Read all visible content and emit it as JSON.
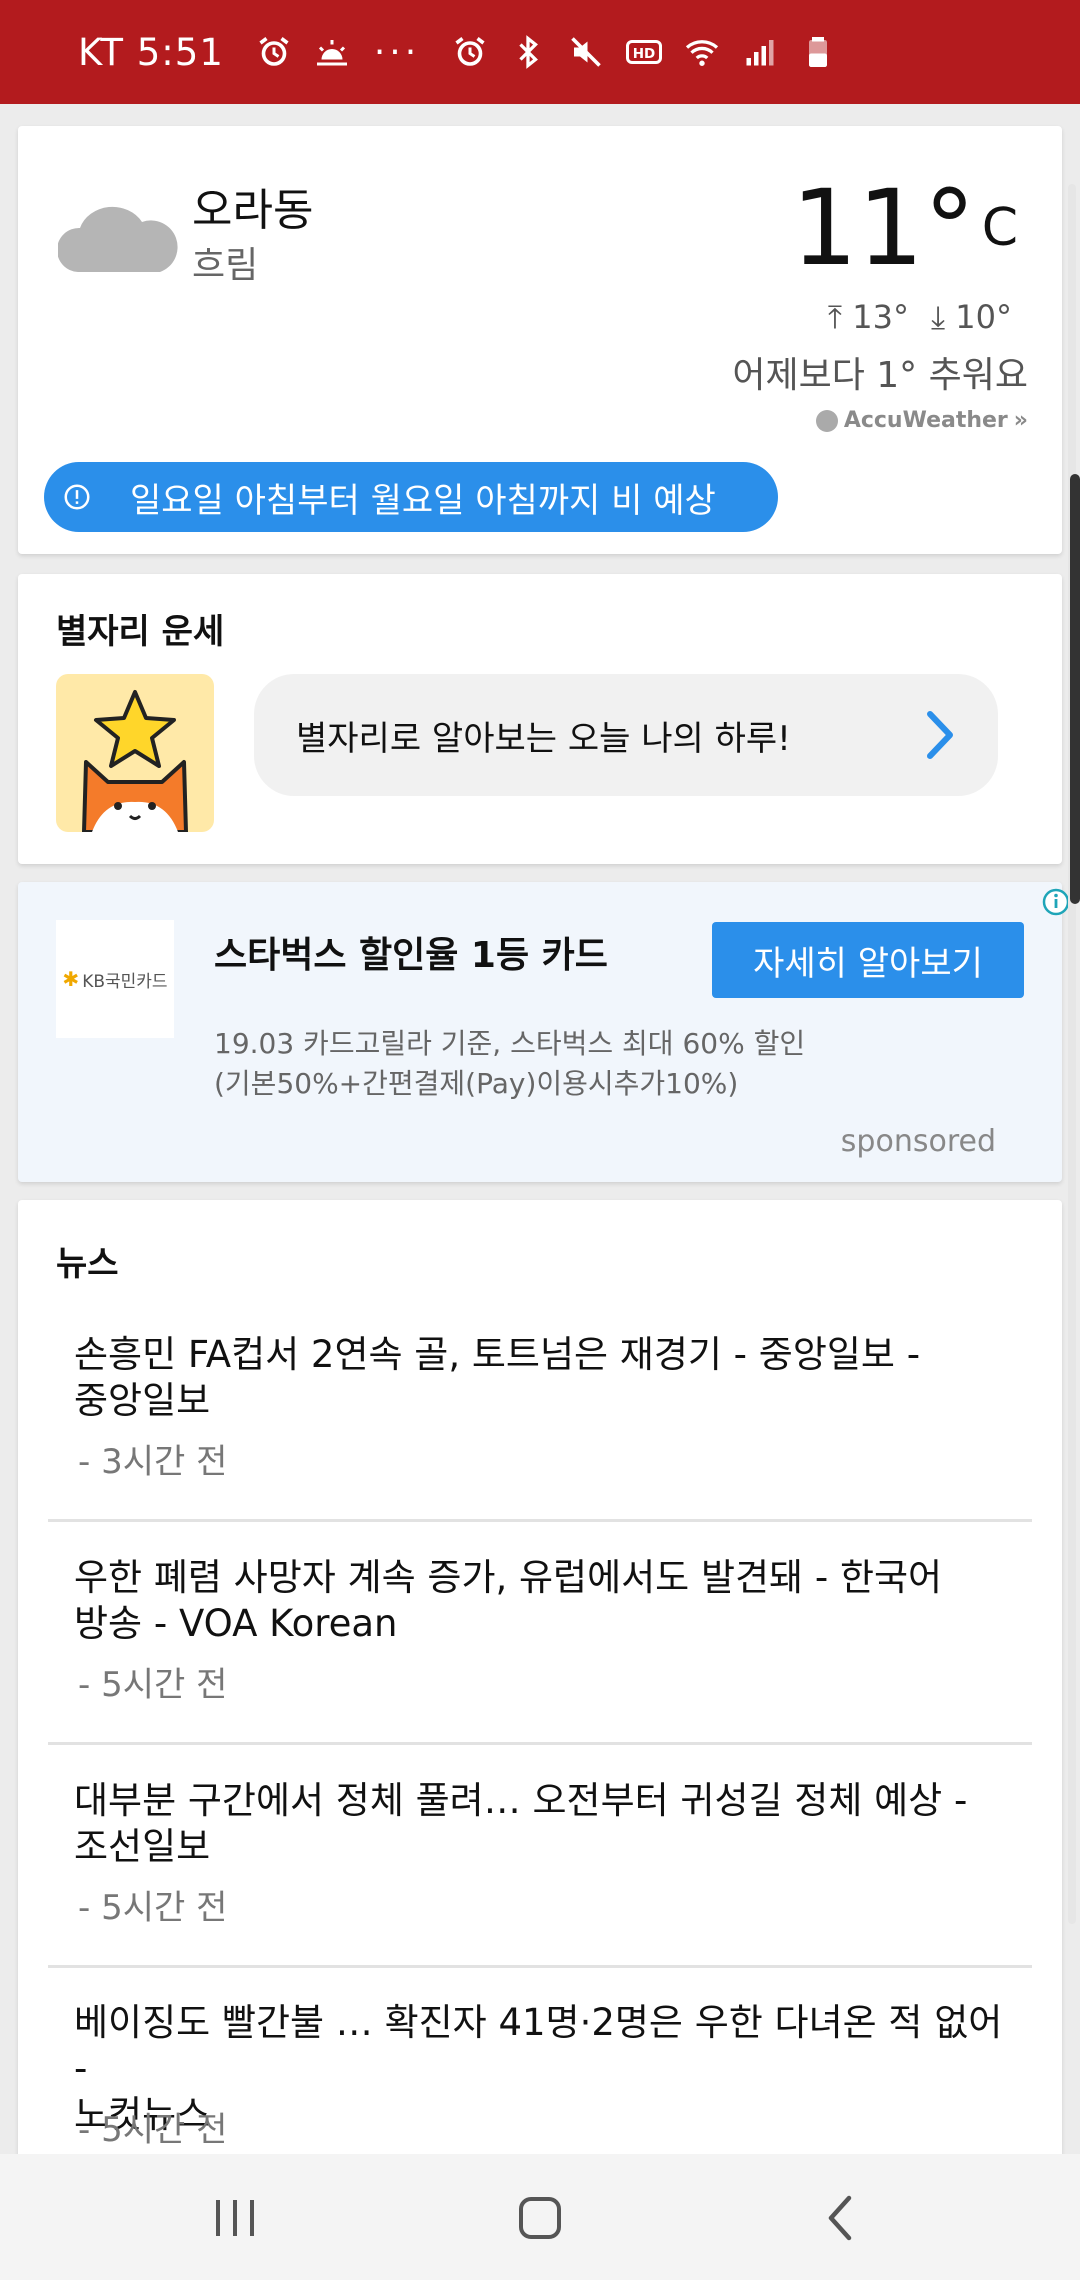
{
  "status_bar": {
    "carrier": "KT",
    "time": "5:51",
    "more": "···",
    "icons": [
      "alarm-icon",
      "sunrise-icon",
      "alarm-icon",
      "bluetooth-icon",
      "mute-icon",
      "hd-icon",
      "wifi-icon",
      "signal-icon",
      "battery-icon"
    ]
  },
  "weather": {
    "location": "오라동",
    "condition": "흐림",
    "temperature": "11°",
    "unit": "C",
    "high": "13°",
    "low": "10°",
    "comparison": "어제보다 1° 추워요",
    "provider": "AccuWeather",
    "alert": "일요일 아침부터 월요일 아침까지 비 예상",
    "icon": "cloud-icon"
  },
  "horoscope": {
    "title": "별자리 운세",
    "message": "별자리로 알아보는 오늘 나의 하루!"
  },
  "ad": {
    "brand": "KB국민카드",
    "title": "스타벅스 할인율 1등 카드",
    "cta": "자세히 알아보기",
    "desc_line1": "19.03 카드고릴라 기준, 스타벅스 최대 60% 할인",
    "desc_line2": "(기본50%+간편결제(Pay)이용시추가10%)",
    "sponsored": "sponsored"
  },
  "news": {
    "title": "뉴스",
    "items": [
      {
        "line1": "손흥민 FA컵서 2연속 골, 토트넘은 재경기 - 중앙일보 -",
        "line2": "중앙일보",
        "time": "- 3시간 전"
      },
      {
        "line1": "우한 폐렴 사망자 계속 증가, 유럽에서도 발견돼 - 한국어",
        "line2": "방송 - VOA Korean",
        "time": "- 5시간 전"
      },
      {
        "line1": "대부분 구간에서 정체 풀려… 오전부터 귀성길 정체 예상 -",
        "line2": "조선일보",
        "time": "- 5시간 전"
      },
      {
        "line1": "베이징도 빨간불 … 확진자 41명·2명은 우한 다녀온 적 없어 -",
        "line2": "노컷뉴스",
        "time": "- 5시간 전"
      }
    ]
  },
  "colors": {
    "status_bar": "#b31b1e",
    "accent": "#2b8fea"
  }
}
